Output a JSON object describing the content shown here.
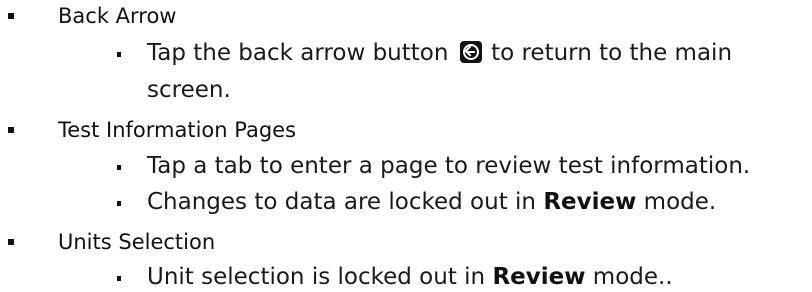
{
  "sections": [
    {
      "title": "Back Arrow",
      "items": [
        {
          "before": "Tap the back arrow button",
          "icon": "back-arrow-icon",
          "after": "to return to the main",
          "continuation": "screen."
        }
      ]
    },
    {
      "title": "Test Information Pages",
      "items": [
        {
          "text": "Tap a tab to enter a page to review test information."
        },
        {
          "before": "Changes to data are locked out in ",
          "bold": "Review",
          "after": " mode."
        }
      ]
    },
    {
      "title": "Units Selection",
      "items": [
        {
          "before": "Unit selection is locked out in ",
          "bold": "Review",
          "after": " mode.."
        }
      ]
    }
  ]
}
